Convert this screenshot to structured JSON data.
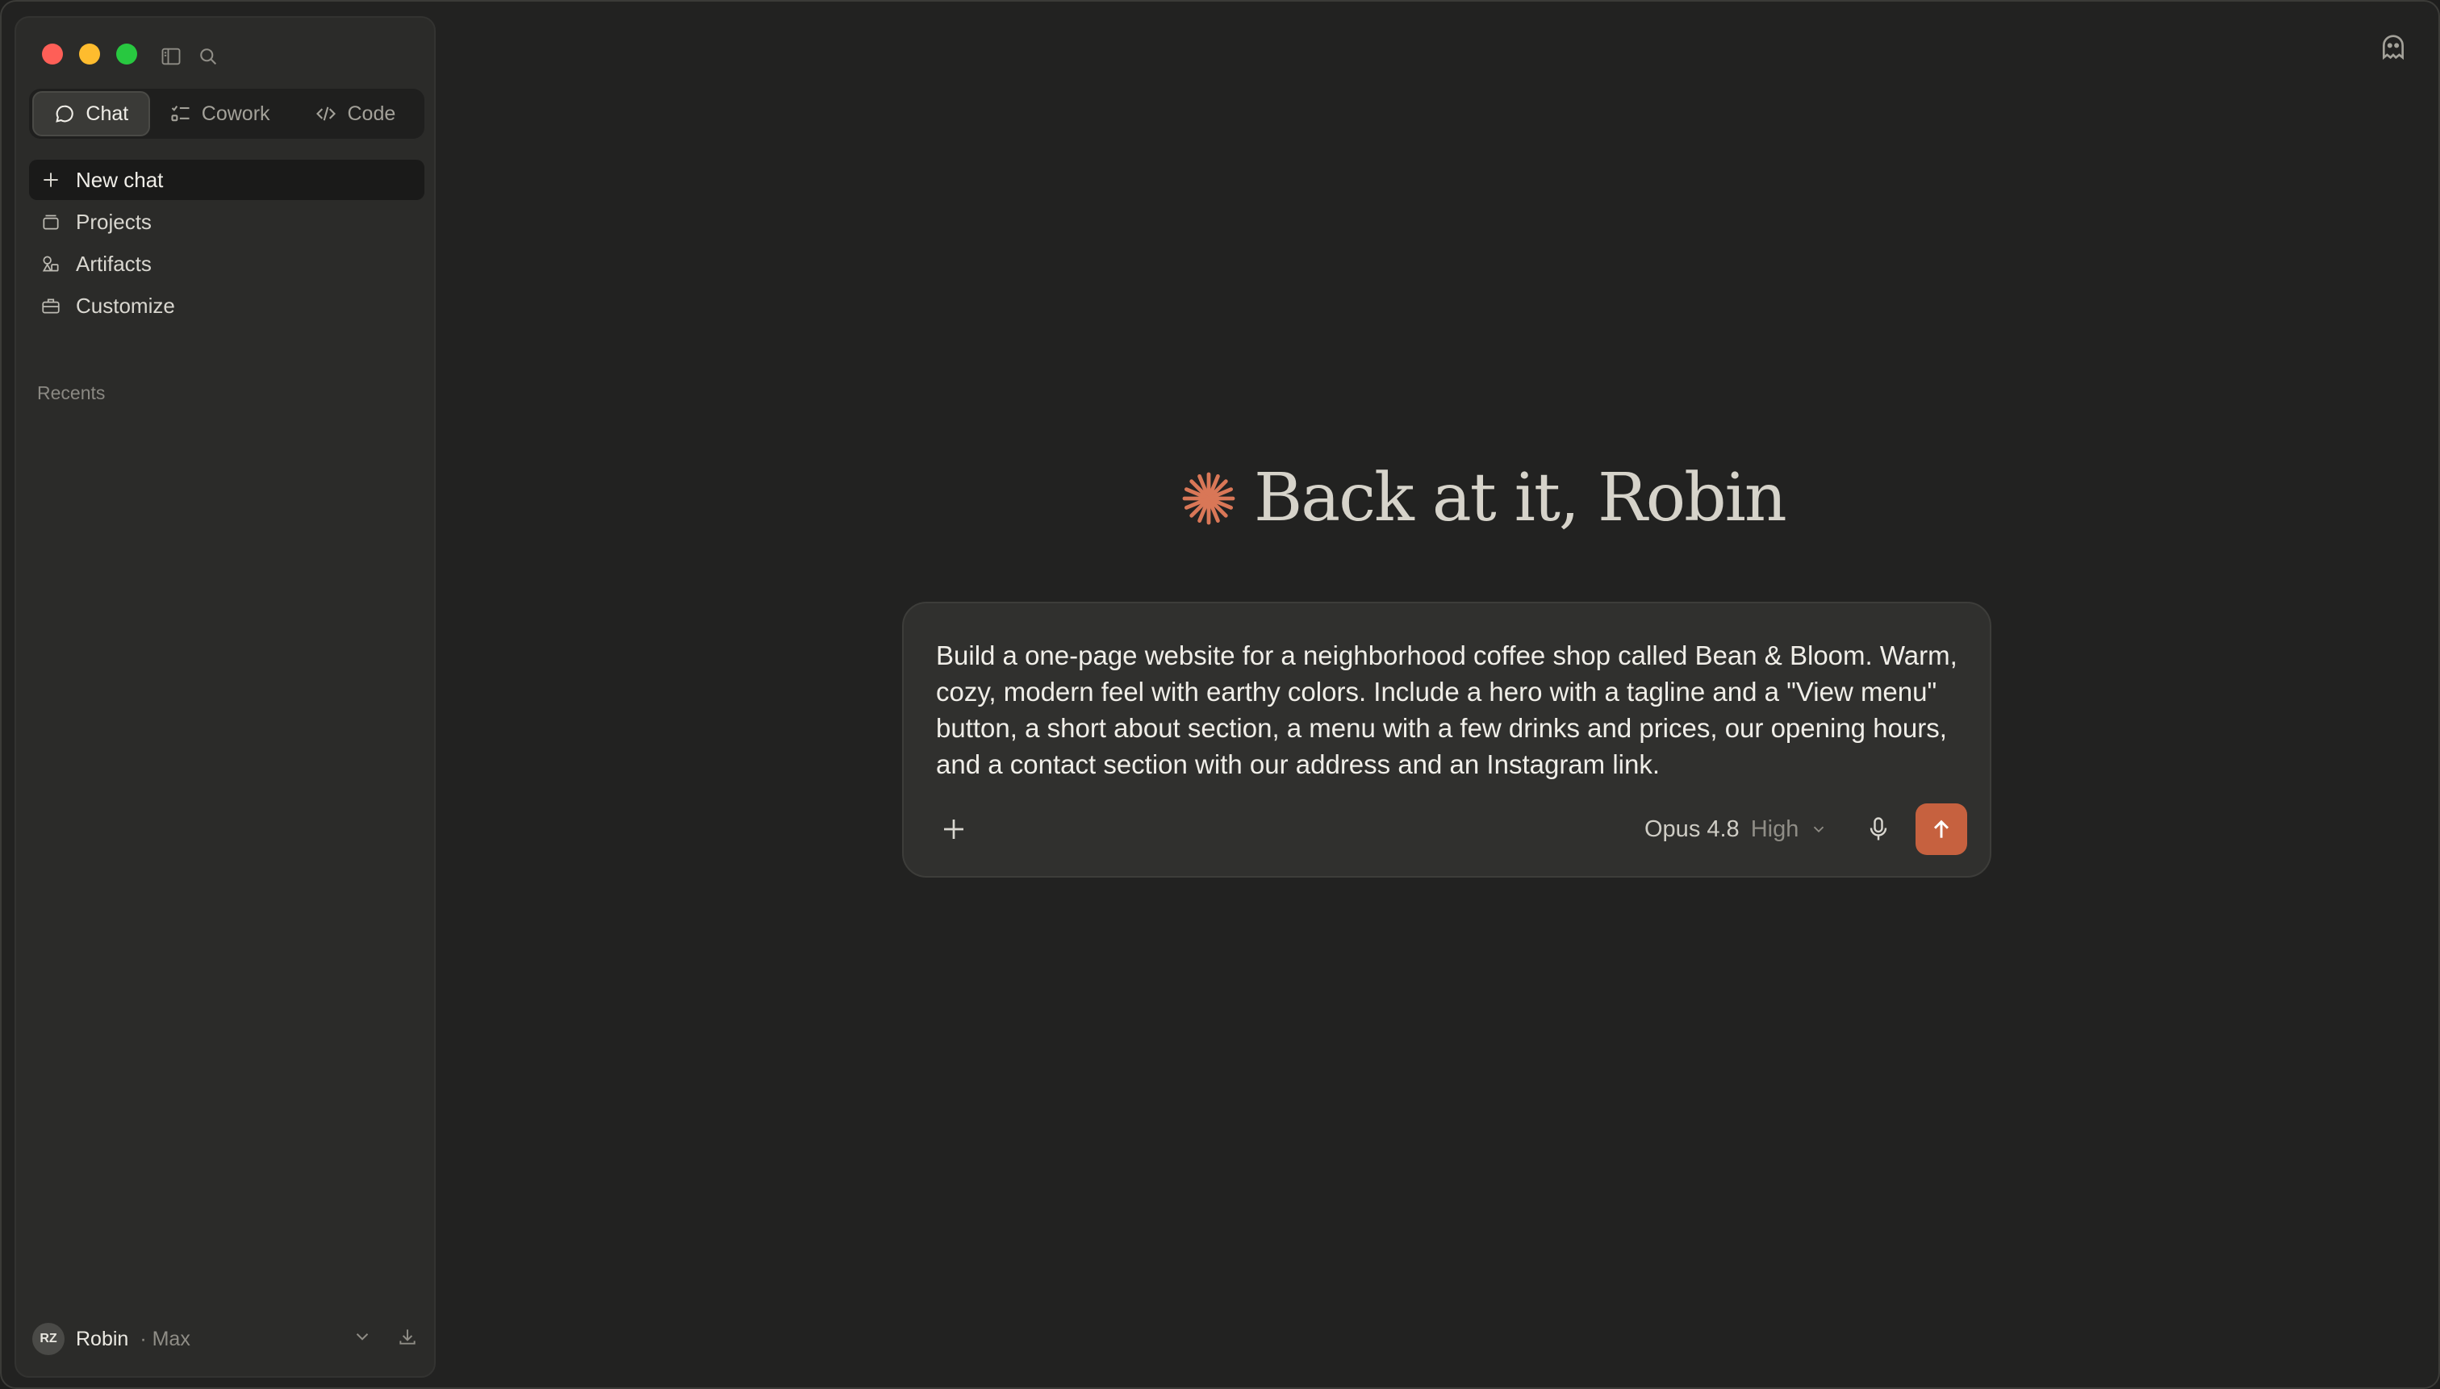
{
  "window": {
    "controls": [
      "close",
      "minimize",
      "zoom"
    ]
  },
  "toolbar": {
    "icons": [
      "sidebar-toggle-icon",
      "search-icon"
    ]
  },
  "modes": [
    {
      "label": "Chat",
      "icon": "chat-bubble-icon",
      "active": true
    },
    {
      "label": "Cowork",
      "icon": "checklist-icon",
      "active": false
    },
    {
      "label": "Code",
      "icon": "code-icon",
      "active": false
    }
  ],
  "nav": [
    {
      "label": "New chat",
      "icon": "plus-icon"
    },
    {
      "label": "Projects",
      "icon": "projects-icon"
    },
    {
      "label": "Artifacts",
      "icon": "artifacts-icon"
    },
    {
      "label": "Customize",
      "icon": "briefcase-icon"
    }
  ],
  "recents": {
    "label": "Recents"
  },
  "profile": {
    "initials": "RZ",
    "name": "Robin",
    "plan": "· Max"
  },
  "greeting": {
    "text": "Back at it, Robin",
    "icon": "spark-icon"
  },
  "composer": {
    "text": "Build a one-page website for a neighborhood coffee shop called Bean & Bloom. Warm, cozy, modern feel with earthy colors. Include a hero with a tagline and a \"View menu\" button, a short about section, a menu with a few drinks and prices, our opening hours, and a contact section with our address and an Instagram link.",
    "model": "Opus 4.8",
    "effort": "High"
  },
  "colors": {
    "accent": "#c6613f",
    "background": "#222221",
    "sidebar": "#2b2b29"
  }
}
